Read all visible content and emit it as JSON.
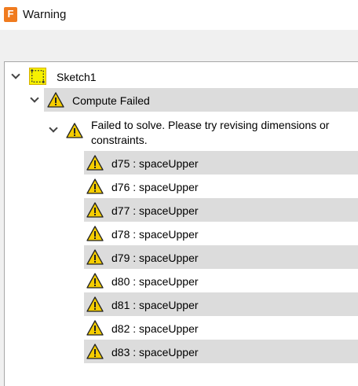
{
  "window": {
    "title": "Warning",
    "app_icon_glyph": "F",
    "accent": "#f07b1f"
  },
  "tree": {
    "root": {
      "label": "Sketch1",
      "icon": "sketch-icon"
    },
    "compute": {
      "label": "Compute Failed",
      "icon": "warning-icon"
    },
    "solve": {
      "line1": "Failed to solve. Please try revising dimensions or",
      "line2": "constraints.",
      "icon": "warning-icon"
    },
    "items": [
      {
        "label": "d75 : spaceUpper"
      },
      {
        "label": "d76 : spaceUpper"
      },
      {
        "label": "d77 : spaceUpper"
      },
      {
        "label": "d78 : spaceUpper"
      },
      {
        "label": "d79 : spaceUpper"
      },
      {
        "label": "d80 : spaceUpper"
      },
      {
        "label": "d81 : spaceUpper"
      },
      {
        "label": "d82 : spaceUpper"
      },
      {
        "label": "d83 : spaceUpper"
      }
    ]
  },
  "colors": {
    "row_highlight": "#dcdcdc",
    "warning_fill": "#f5cd00"
  }
}
